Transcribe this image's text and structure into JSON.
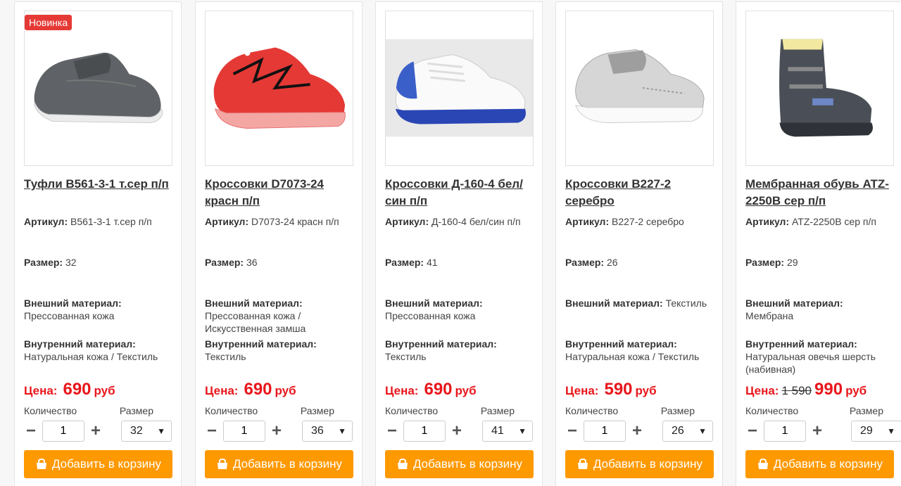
{
  "products": [
    {
      "badge": "Новинка",
      "title": "Туфли B561-3-1 т.сер п/п",
      "sku_label": "Артикул:",
      "sku": "B561-3-1 т.сер п/п",
      "size_label": "Размер:",
      "size": "32",
      "outer_label": "Внешний материал:",
      "outer": "Прессованная кожа",
      "inner_label": "Внутренний материал:",
      "inner": "Натуральная кожа / Текстиль",
      "price_label": "Цена:",
      "old_price": "",
      "price": "690",
      "currency": "руб",
      "qty_label": "Количество",
      "qty": "1",
      "size_select_label": "Размер",
      "size_selected": "32",
      "cart_label": "Добавить в корзину",
      "image": "grey-shoe-image"
    },
    {
      "badge": "",
      "title": "Кроссовки D7073-24 красн п/п",
      "sku_label": "Артикул:",
      "sku": "D7073-24 красн п/п",
      "size_label": "Размер:",
      "size": "36",
      "outer_label": "Внешний материал:",
      "outer": "Прессованная кожа / Искусственная замша",
      "inner_label": "Внутренний материал:",
      "inner": "Текстиль",
      "price_label": "Цена:",
      "old_price": "",
      "price": "690",
      "currency": "руб",
      "qty_label": "Количество",
      "qty": "1",
      "size_select_label": "Размер",
      "size_selected": "36",
      "cart_label": "Добавить в корзину",
      "image": "red-sneaker-image"
    },
    {
      "badge": "",
      "title": "Кроссовки Д-160-4 бел/син п/п",
      "sku_label": "Артикул:",
      "sku": "Д-160-4 бел/син п/п",
      "size_label": "Размер:",
      "size": "41",
      "outer_label": "Внешний материал:",
      "outer": "Прессованная кожа",
      "inner_label": "Внутренний материал:",
      "inner": "Текстиль",
      "price_label": "Цена:",
      "old_price": "",
      "price": "690",
      "currency": "руб",
      "qty_label": "Количество",
      "qty": "1",
      "size_select_label": "Размер",
      "size_selected": "41",
      "cart_label": "Добавить в корзину",
      "image": "white-blue-sneaker-image"
    },
    {
      "badge": "",
      "title": "Кроссовки B227-2 серебро",
      "sku_label": "Артикул:",
      "sku": "B227-2 серебро",
      "size_label": "Размер:",
      "size": "26",
      "outer_label": "Внешний материал:",
      "outer": "Текстиль",
      "inner_label": "Внутренний материал:",
      "inner": "Натуральная кожа / Текстиль",
      "price_label": "Цена:",
      "old_price": "",
      "price": "590",
      "currency": "руб",
      "qty_label": "Количество",
      "qty": "1",
      "size_select_label": "Размер",
      "size_selected": "26",
      "cart_label": "Добавить в корзину",
      "image": "silver-sneaker-image"
    },
    {
      "badge": "",
      "title": "Мембранная обувь ATZ-2250B сер п/п",
      "sku_label": "Артикул:",
      "sku": "ATZ-2250B сер п/п",
      "size_label": "Размер:",
      "size": "29",
      "outer_label": "Внешний материал:",
      "outer": "Мембрана",
      "inner_label": "Внутренний материал:",
      "inner": "Натуральная овечья шерсть (набивная)",
      "price_label": "Цена:",
      "old_price": "1 590",
      "price": "990",
      "currency": "руб",
      "qty_label": "Количество",
      "qty": "1",
      "size_select_label": "Размер",
      "size_selected": "29",
      "cart_label": "Добавить в корзину",
      "image": "winter-boot-image"
    }
  ],
  "colors": {
    "price": "#e8161b",
    "cart_button": "#ff9900",
    "badge": "#e53935"
  },
  "icons": {
    "minus": "−",
    "plus": "+",
    "chevron": "⌄",
    "cart": "bag-icon"
  }
}
